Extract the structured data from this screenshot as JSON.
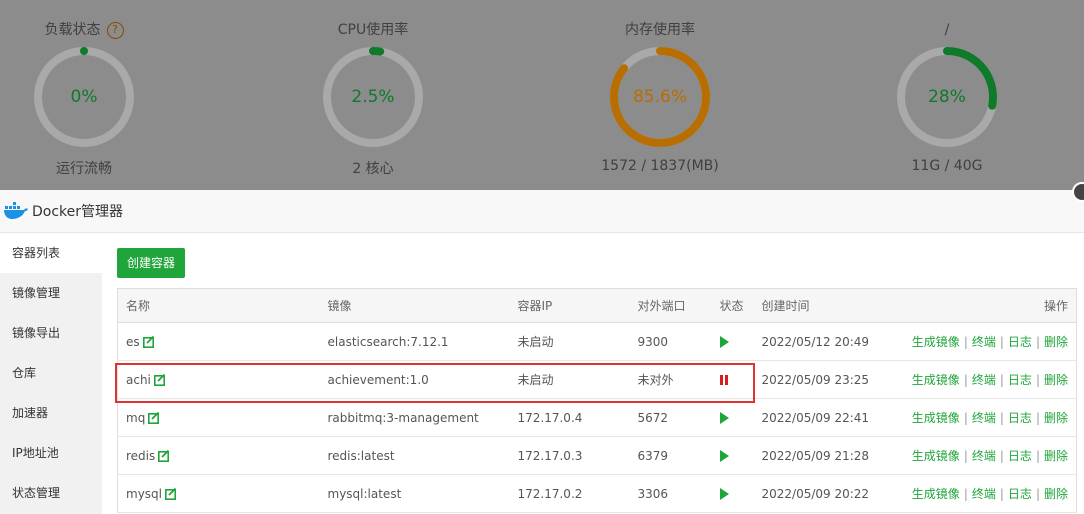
{
  "dashboard": {
    "gauges": [
      {
        "title": "负载状态",
        "value": "0%",
        "sub": "运行流畅",
        "percent": 0,
        "color": "#0e7a2a",
        "has_help": true
      },
      {
        "title": "CPU使用率",
        "value": "2.5%",
        "sub": "2 核心",
        "percent": 2.5,
        "color": "#0e7a2a",
        "has_help": false
      },
      {
        "title": "内存使用率",
        "value": "85.6%",
        "sub": "1572 / 1837(MB)",
        "percent": 85.6,
        "color": "#b86e00",
        "has_help": false
      },
      {
        "title": "/",
        "value": "28%",
        "sub": "11G / 40G",
        "percent": 28,
        "color": "#0e7a2a",
        "has_help": false
      }
    ],
    "help_glyph": "?"
  },
  "dialog": {
    "title": "Docker管理器"
  },
  "sidebar": {
    "items": [
      {
        "label": "容器列表",
        "active": true
      },
      {
        "label": "镜像管理",
        "active": false
      },
      {
        "label": "镜像导出",
        "active": false
      },
      {
        "label": "仓库",
        "active": false
      },
      {
        "label": "加速器",
        "active": false
      },
      {
        "label": "IP地址池",
        "active": false
      },
      {
        "label": "状态管理",
        "active": false
      }
    ]
  },
  "main": {
    "create_label": "创建容器",
    "columns": [
      "名称",
      "镜像",
      "容器IP",
      "对外端口",
      "状态",
      "创建时间",
      "操作"
    ],
    "rows": [
      {
        "name": "es",
        "image": "elasticsearch:7.12.1",
        "ip": "未启动",
        "port": "9300",
        "status": "running",
        "time": "2022/05/12 20:49"
      },
      {
        "name": "achi",
        "image": "achievement:1.0",
        "ip": "未启动",
        "port": "未对外",
        "status": "stopped",
        "time": "2022/05/09 23:25"
      },
      {
        "name": "mq",
        "image": "rabbitmq:3-management",
        "ip": "172.17.0.4",
        "port": "5672",
        "status": "running",
        "time": "2022/05/09 22:41"
      },
      {
        "name": "redis",
        "image": "redis:latest",
        "ip": "172.17.0.3",
        "port": "6379",
        "status": "running",
        "time": "2022/05/09 21:28"
      },
      {
        "name": "mysql",
        "image": "mysql:latest",
        "ip": "172.17.0.2",
        "port": "3306",
        "status": "running",
        "time": "2022/05/09 20:22"
      }
    ],
    "actions": [
      "生成镜像",
      "终端",
      "日志",
      "删除"
    ],
    "separator": "|"
  },
  "colors": {
    "accent": "#20a53a",
    "danger": "#d61e1e",
    "highlight": "#e03434"
  }
}
